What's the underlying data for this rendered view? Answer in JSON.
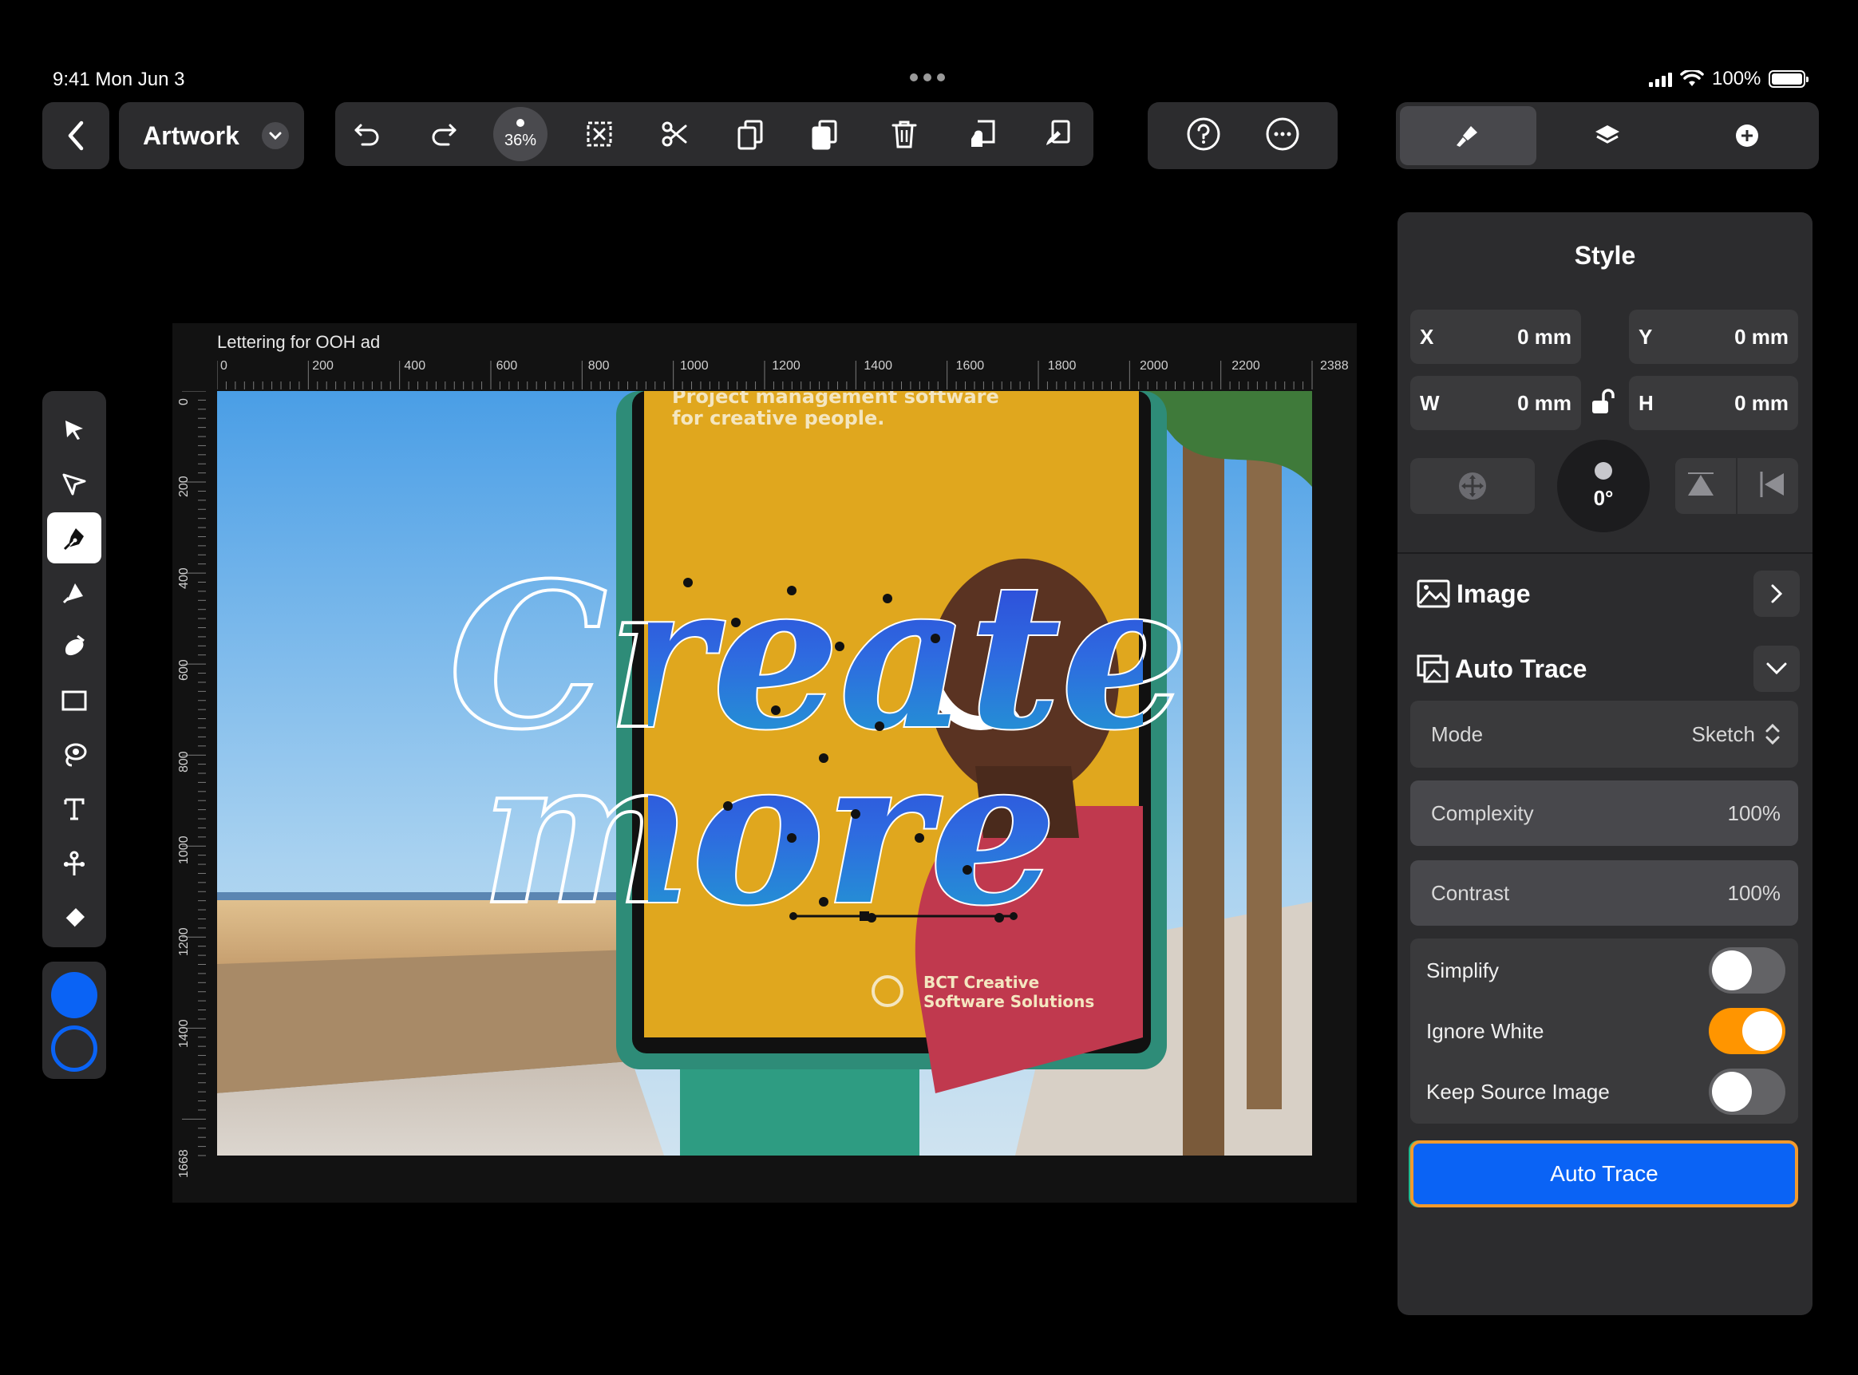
{
  "status_bar": {
    "time": "9:41  Mon Jun 3",
    "battery": "100%"
  },
  "header": {
    "document_title": "Artwork",
    "zoom_level": "36%"
  },
  "canvas": {
    "artboard_title": "Lettering for OOH ad",
    "ruler_top": [
      "0",
      "200",
      "400",
      "600",
      "800",
      "1000",
      "1200",
      "1400",
      "1600",
      "1800",
      "2000",
      "2200",
      "2388"
    ],
    "ruler_left": [
      "0",
      "200",
      "400",
      "600",
      "800",
      "1000",
      "1200",
      "1400",
      "1668"
    ],
    "artwork": {
      "billboard_tagline_1": "Project management software",
      "billboard_tagline_2": "for creative people.",
      "lettering_line_1": "Create",
      "lettering_line_2": "more",
      "brand_line_1": "BCT Creative",
      "brand_line_2": "Software Solutions"
    }
  },
  "colors": {
    "fill": "#0a63f5",
    "stroke": "#0a63f5",
    "accent": "#ff9500"
  },
  "style_panel": {
    "title": "Style",
    "x_label": "X",
    "x_value": "0 mm",
    "y_label": "Y",
    "y_value": "0 mm",
    "w_label": "W",
    "w_value": "0 mm",
    "h_label": "H",
    "h_value": "0 mm",
    "rotation": "0°",
    "image_section": "Image",
    "auto_trace_section": "Auto Trace",
    "mode_label": "Mode",
    "mode_value": "Sketch",
    "complexity_label": "Complexity",
    "complexity_value": "100%",
    "contrast_label": "Contrast",
    "contrast_value": "100%",
    "simplify_label": "Simplify",
    "simplify_on": false,
    "ignore_white_label": "Ignore White",
    "ignore_white_on": true,
    "keep_source_label": "Keep Source Image",
    "keep_source_on": false,
    "auto_trace_button": "Auto Trace"
  }
}
